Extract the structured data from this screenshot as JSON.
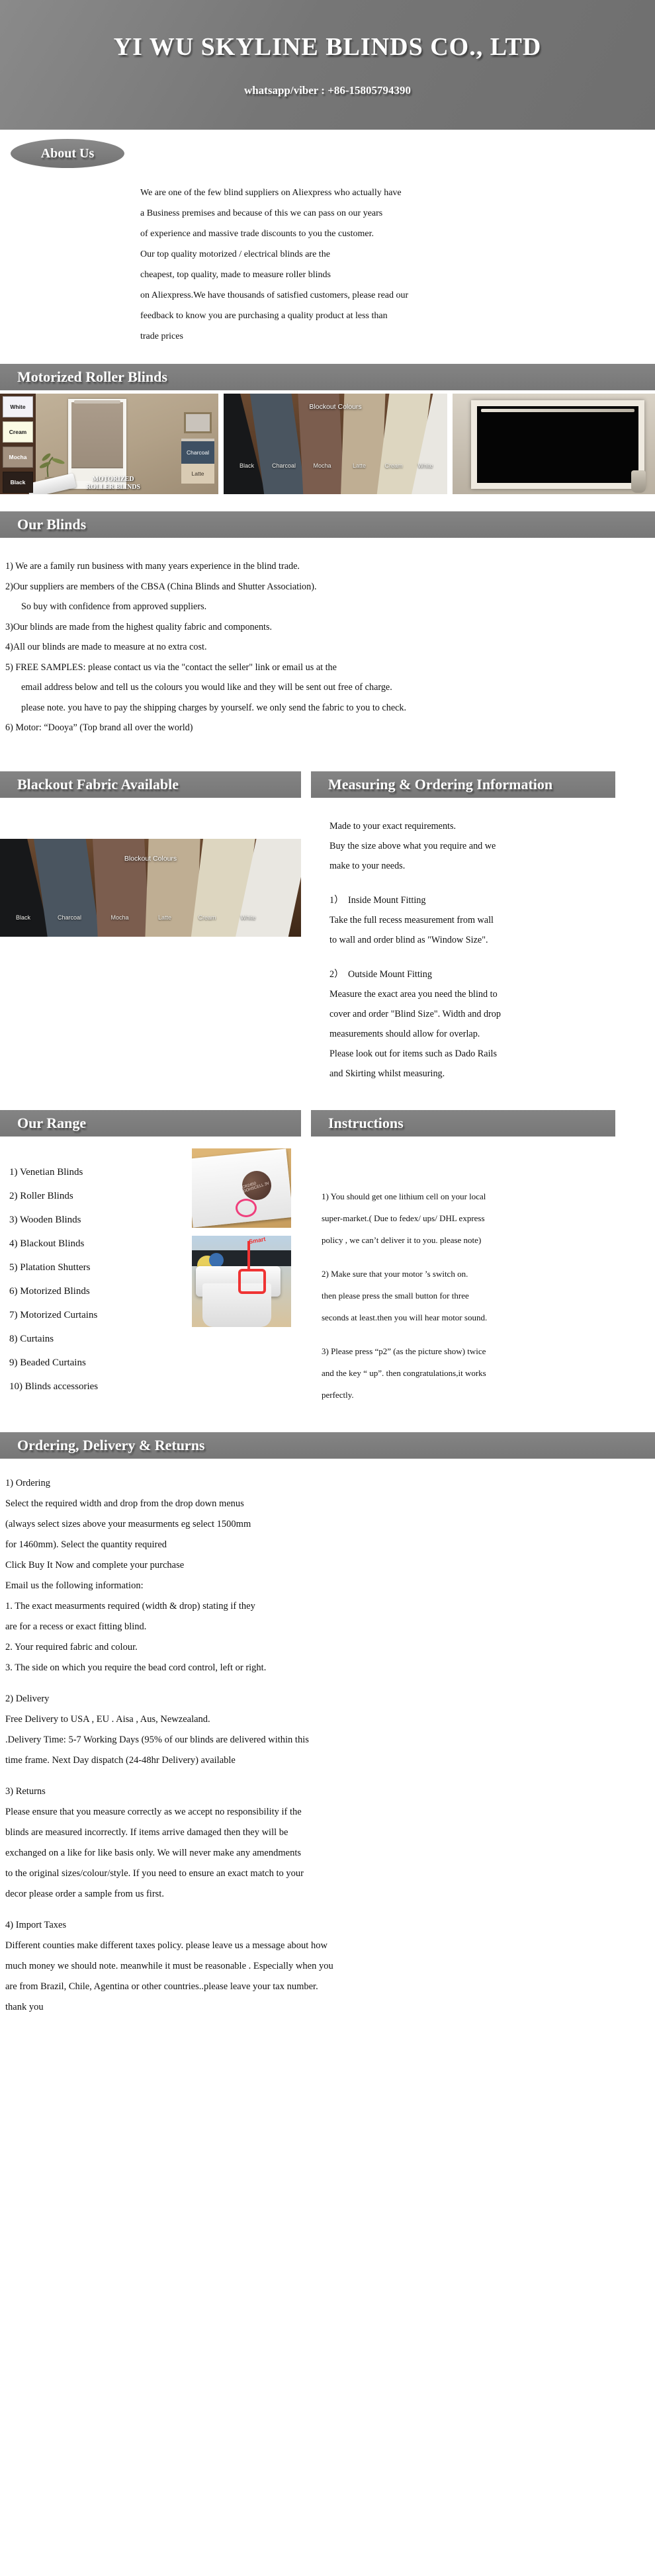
{
  "hero": {
    "company": "YI WU  SKYLINE  BLINDS  CO., LTD",
    "contact": "whatsapp/viber : +86-15805794390"
  },
  "about": {
    "badge": "About  Us",
    "lines": [
      "We are one of the few blind suppliers on Aliexpress  who actually have",
      " a Business premises and because of this we can pass on our years",
      "of experience and massive trade discounts to you the customer.",
      "Our top quality motorized  / electrical  blinds  are the",
      "cheapest, top quality, made to measure roller blinds",
      "on Aliexpress.We have thousands of satisfied customers, please read our",
      "feedback to know you are purchasing a quality product at less than",
      "trade prices"
    ]
  },
  "motorized": {
    "title": "Motorized  Roller Blinds",
    "room_swatches": [
      "White",
      "Cream",
      "Mocha",
      "Black"
    ],
    "room_labels": [
      "Charcoal",
      "Latte"
    ],
    "room_caption_line1": "MOTORIZED",
    "room_caption_line2": "ROLLER  BLINDS",
    "fan_caption": "Blockout Colours",
    "fan_labels": [
      "Black",
      "Charcoal",
      "Mocha",
      "Latte",
      "Cream",
      "White"
    ],
    "fan_colors": [
      "#17181a",
      "#4a5560",
      "#7b5d4e",
      "#bfae93",
      "#ddd6c0",
      "#e9e7e1"
    ]
  },
  "our_blinds": {
    "title": "Our  Blinds",
    "lines": [
      "1) We are a family run business with many years experience in the blind trade.",
      "2)Our suppliers are members of the CBSA (China Blinds and Shutter Association).",
      "So buy with confidence from approved suppliers.",
      "3)Our blinds are made from the highest quality fabric and components.",
      "4)All our blinds are made to measure at no extra cost.",
      "5) FREE SAMPLES: please contact us via the \"contact the seller\" link or email us at the",
      "email address below and tell us the colours you would like and they will be sent out free of charge.",
      "please note.  you have to pay the shipping charges by yourself. we only send the fabric to you to check.",
      "6) Motor:   “Dooya” (Top brand all over the world)"
    ]
  },
  "blackout": {
    "title": "Blackout Fabric Available",
    "photo_caption": "Blockout Colours",
    "fan_labels": [
      "Black",
      "Charcoal",
      "Mocha",
      "Latte",
      "Cream",
      "White"
    ],
    "fan_colors": [
      "#17181a",
      "#4a5560",
      "#7b5d4e",
      "#bfae93",
      "#ddd6c0",
      "#e9e7e1"
    ]
  },
  "measuring": {
    "title": "Measuring &  Ordering  Information",
    "intro": [
      "Made to your exact requirements.",
      "Buy the size above what you require and we",
      "make to your needs."
    ],
    "item1_num": "1）",
    "item1_head": "Inside Mount Fitting",
    "item1_lines": [
      "Take the full recess measurement from wall",
      "to wall and order blind as \"Window Size\"."
    ],
    "item2_num": "2）",
    "item2_head": "Outside Mount Fitting",
    "item2_lines": [
      "Measure the exact area you need the blind to",
      "cover and order \"Blind Size\". Width and drop",
      " measurements should allow for overlap.",
      "Please look out for items such as Dado Rails",
      "and Skirting whilst measuring."
    ]
  },
  "range": {
    "title": "Our  Range",
    "items": [
      "1)  Venetian  Blinds",
      "2)  Roller  Blinds",
      "3)  Wooden Blinds",
      "4)  Blackout Blinds",
      "5)  Platation Shutters",
      "6)  Motorized Blinds",
      "7)  Motorized Curtains",
      "8)  Curtains",
      "9) Beaded  Curtains",
      "10) Blinds accessories"
    ],
    "battery_text": "CR2450 DOHSCELL 3V"
  },
  "instructions": {
    "title": "Instructions",
    "steps": [
      "1) You should get one lithium cell on your local",
      "super-market.( Due to fedex/ ups/ DHL express",
      " policy , we can’t  deliver it to  you. please note)",
      "2)  Make sure that your motor ’s  switch on.",
      "then please  press the small button for three",
      "seconds at least.then you will hear motor sound.",
      "3) Please press  “p2” (as the picture show)  twice",
      " and the key “ up”. then  congratulations,it works",
      " perfectly."
    ],
    "motor_mark_label": "Smart"
  },
  "ordering": {
    "title": "Ordering,  Delivery & Returns",
    "sections": [
      {
        "head": "1)  Ordering",
        "lines": [
          "Select the required width and drop from the drop down menus",
          "(always select sizes above your measurments eg select 1500mm",
          "for 1460mm).   Select the quantity required",
          "Click Buy It Now and complete your purchase",
          "Email us the following information:",
          "1. The exact measurments required (width & drop) stating if they",
          "are for a recess or exact fitting blind.",
          "2. Your required fabric and colour.",
          "3. The side on which you require the bead cord control, left or right."
        ]
      },
      {
        "head": "2) Delivery",
        "lines": [
          "Free Delivery to  USA , EU . Aisa , Aus, Newzealand.",
          ".Delivery Time: 5-7 Working Days (95% of our blinds are delivered within this",
          "time frame. Next Day dispatch (24-48hr Delivery) available"
        ]
      },
      {
        "head": "3) Returns",
        "lines": [
          "Please ensure that you measure correctly as we accept no responsibility if the",
          " blinds are measured incorrectly. If items arrive damaged then they will be",
          "exchanged on a like for like basis only. We will never make any amendments",
          "to the original sizes/colour/style. If you need to ensure an exact match to your",
          "decor please order a sample from us first."
        ]
      },
      {
        "head": "4) Import  Taxes",
        "lines": [
          "Different counties make different  taxes policy.  please leave us a message about  how",
          "much money we should note. meanwhile it must be reasonable . Especially when  you",
          "are from  Brazil, Chile, Agentina or other countries..please leave your  tax number.",
          "thank you"
        ]
      }
    ]
  },
  "colors": {
    "bar_grey": "#7d7d7d",
    "hero_grey": "#767676",
    "text_black": "#101010"
  }
}
